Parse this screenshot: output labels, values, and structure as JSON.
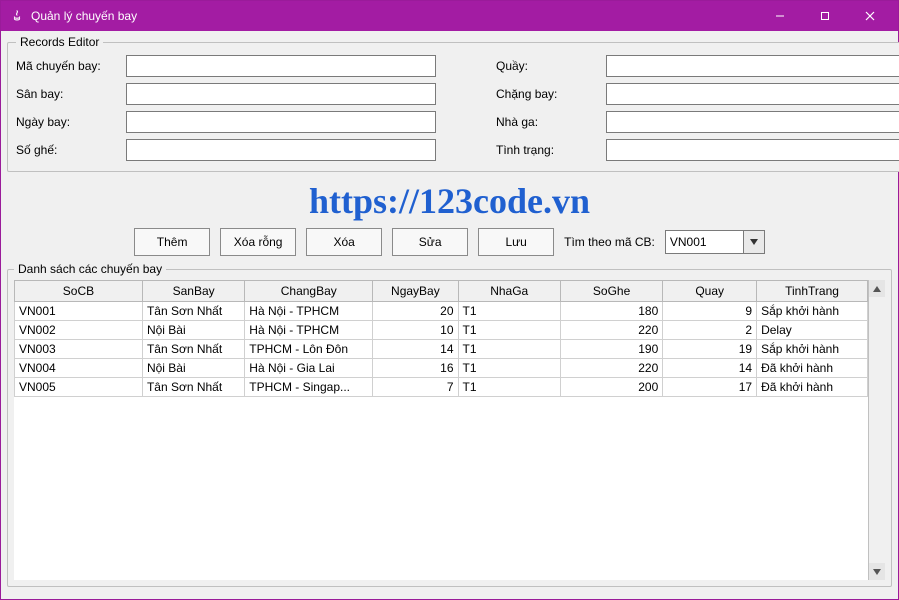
{
  "window": {
    "title": "Quản lý chuyến bay"
  },
  "editor": {
    "legend": "Records Editor",
    "labels": {
      "flight_code": "Mã chuyến bay:",
      "airport": "Sân bay:",
      "fly_date": "Ngày bay:",
      "seats": "Số ghế:",
      "counter": "Quầy:",
      "route": "Chặng bay:",
      "terminal": "Nhà ga:",
      "status": "Tình trạng:"
    },
    "values": {
      "flight_code": "",
      "airport": "",
      "fly_date": "",
      "seats": "",
      "counter": "",
      "route": "",
      "terminal": "",
      "status": ""
    }
  },
  "watermark": "https://123code.vn",
  "toolbar": {
    "add": "Thêm",
    "clear": "Xóa rỗng",
    "delete": "Xóa",
    "edit": "Sửa",
    "save": "Lưu",
    "search_label": "Tìm theo mã CB:",
    "search_value": "VN001"
  },
  "list": {
    "legend": "Danh sách các chuyến bay",
    "columns": [
      "SoCB",
      "SanBay",
      "ChangBay",
      "NgayBay",
      "NhaGa",
      "SoGhe",
      "Quay",
      "TinhTrang"
    ],
    "rows": [
      {
        "SoCB": "VN001",
        "SanBay": "Tân Sơn Nhất",
        "ChangBay": "Hà Nội - TPHCM",
        "NgayBay": 20,
        "NhaGa": "T1",
        "SoGhe": 180,
        "Quay": 9,
        "TinhTrang": "Sắp khởi hành"
      },
      {
        "SoCB": "VN002",
        "SanBay": "Nội Bài",
        "ChangBay": "Hà Nội - TPHCM",
        "NgayBay": 10,
        "NhaGa": "T1",
        "SoGhe": 220,
        "Quay": 2,
        "TinhTrang": "Delay"
      },
      {
        "SoCB": "VN003",
        "SanBay": "Tân Sơn Nhất",
        "ChangBay": "TPHCM - Lôn Đôn",
        "NgayBay": 14,
        "NhaGa": "T1",
        "SoGhe": 190,
        "Quay": 19,
        "TinhTrang": "Sắp khởi hành"
      },
      {
        "SoCB": "VN004",
        "SanBay": "Nội Bài",
        "ChangBay": "Hà Nội - Gia Lai",
        "NgayBay": 16,
        "NhaGa": "T1",
        "SoGhe": 220,
        "Quay": 14,
        "TinhTrang": "Đã khởi hành"
      },
      {
        "SoCB": "VN005",
        "SanBay": "Tân Sơn Nhất",
        "ChangBay": "TPHCM - Singap...",
        "NgayBay": 7,
        "NhaGa": "T1",
        "SoGhe": 200,
        "Quay": 17,
        "TinhTrang": "Đã khởi hành"
      }
    ]
  }
}
